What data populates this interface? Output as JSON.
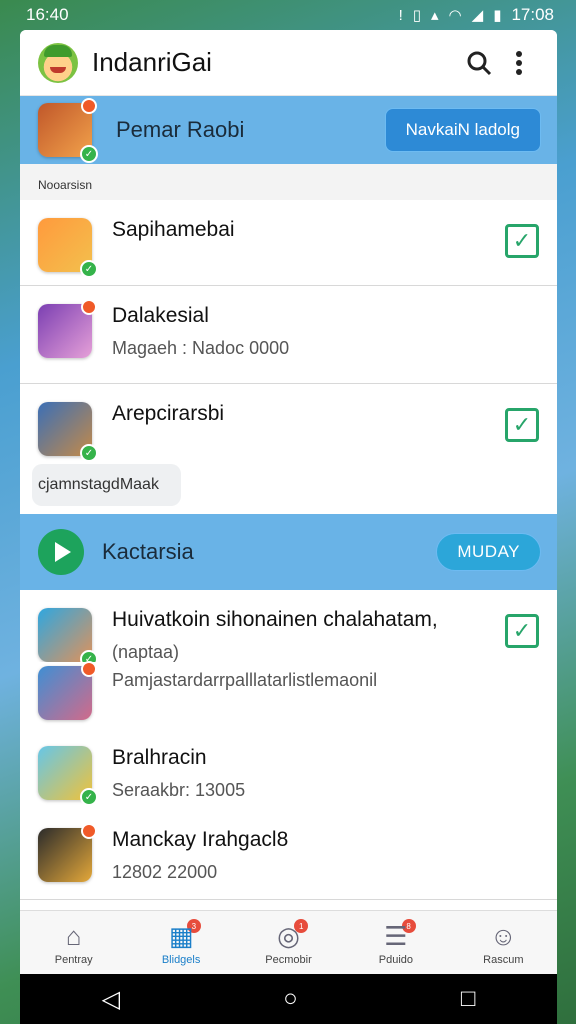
{
  "status": {
    "time_left": "16:40",
    "time_right": "17:08"
  },
  "app": {
    "title": "IndanriGai"
  },
  "section1": {
    "title": "Pemar Raobi",
    "button": "NavkaiN ladolg",
    "caption": "Nooarsisn"
  },
  "items1": [
    {
      "name": "Sapihamebai",
      "sub": "",
      "checked": true,
      "colors": [
        "#ff9a3d",
        "#f3c04d"
      ]
    },
    {
      "name": "Dalakesial",
      "sub": "Magaeh : Nadoc 0000",
      "checked": false,
      "colors": [
        "#7b3fb2",
        "#e6a0d8"
      ]
    },
    {
      "name": "Arepcirarsbi",
      "sub": "",
      "checked": true,
      "colors": [
        "#3b6fb6",
        "#c48a48"
      ]
    }
  ],
  "toast": "cjamnstagdMaak",
  "section2": {
    "title": "Kactarsia",
    "button": "MUDAY"
  },
  "items2": [
    {
      "name": "Huivatkoin sihonainen chalahatam,",
      "sub": "(naptaa)",
      "checked": true,
      "colors": [
        "#2fa7e0",
        "#e0925a"
      ]
    },
    {
      "name": "",
      "sub": "Pamjastardarrpalllatarlistlemaonil",
      "checked": false,
      "colors": [
        "#3f8fd4",
        "#d26a8a"
      ]
    },
    {
      "name": "Bralhracin",
      "sub": "Seraakbr: 13005",
      "checked": false,
      "colors": [
        "#66c6e8",
        "#f0c23a"
      ]
    },
    {
      "name": "Manckay Irahgacl8",
      "sub": "12802  22000",
      "checked": false,
      "colors": [
        "#2b2b2b",
        "#e4a83a"
      ]
    }
  ],
  "nav": [
    {
      "label": "Pentray",
      "icon": "home-icon",
      "glyph": "⌂",
      "badge": ""
    },
    {
      "label": "Blidgels",
      "icon": "store-icon",
      "glyph": "▦",
      "badge": "3"
    },
    {
      "label": "Pecmobir",
      "icon": "compass-icon",
      "glyph": "◎",
      "badge": "1"
    },
    {
      "label": "Pduido",
      "icon": "news-icon",
      "glyph": "☰",
      "badge": "8"
    },
    {
      "label": "Rascum",
      "icon": "profile-icon",
      "glyph": "☺",
      "badge": ""
    }
  ],
  "sysnav": {
    "back": "◁",
    "home": "○",
    "recent": "□"
  }
}
